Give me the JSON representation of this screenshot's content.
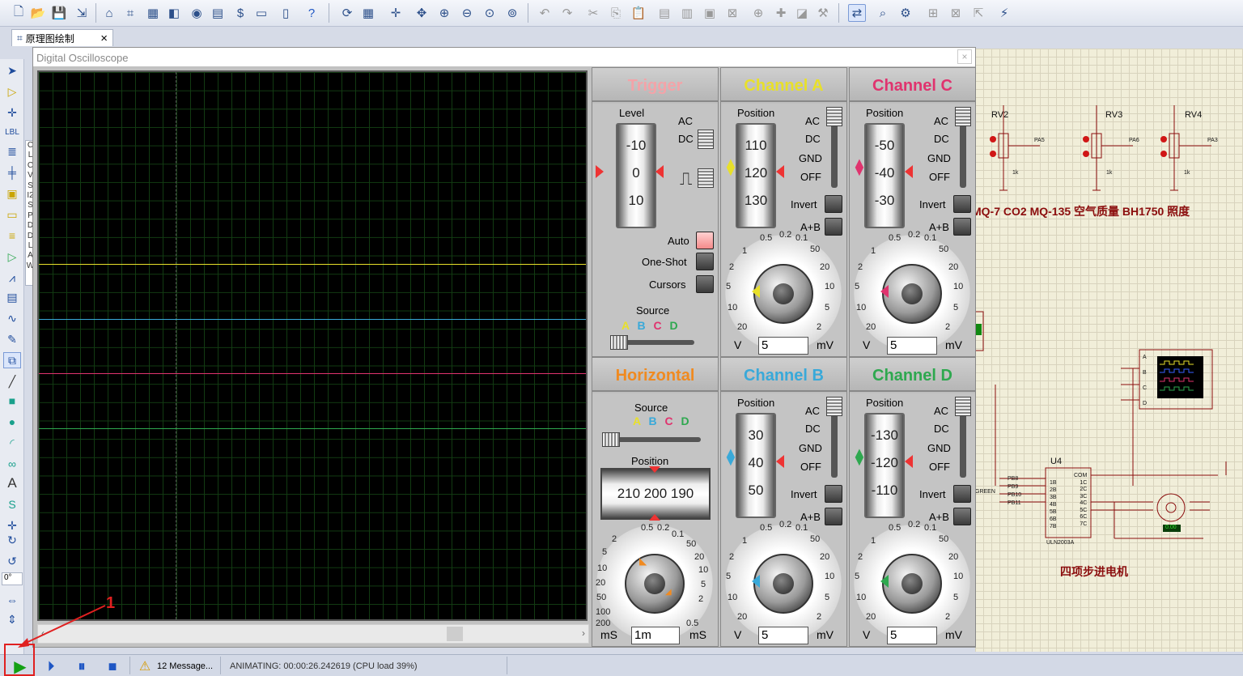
{
  "tab": {
    "label": "原理图绘制",
    "close": "×"
  },
  "device_strip": [
    "C",
    "L",
    "C",
    "V",
    "S",
    "I2",
    "S",
    "P",
    "D",
    "D",
    "L",
    "A",
    "W"
  ],
  "palette": {
    "angle_label": "0°"
  },
  "oscilloscope": {
    "title": "Digital Oscilloscope",
    "close": "×",
    "trigger": {
      "header": "Trigger",
      "level_label": "Level",
      "level_ticks": [
        "-10",
        "0",
        "10"
      ],
      "ac": "AC",
      "dc": "DC",
      "auto": "Auto",
      "one_shot": "One-Shot",
      "cursors": "Cursors",
      "source_label": "Source",
      "sources": [
        "A",
        "B",
        "C",
        "D"
      ]
    },
    "horizontal": {
      "header": "Horizontal",
      "source_label": "Source",
      "sources": [
        "A",
        "B",
        "C",
        "D"
      ],
      "position_label": "Position",
      "position_ticks": "210 200 190",
      "dial_labels": [
        "0.5",
        "0.2",
        "0.1",
        "50",
        "20",
        "10",
        "5",
        "2",
        "0.5",
        "200",
        "100",
        "50",
        "20",
        "10",
        "5",
        "2"
      ],
      "unit_left": "mS",
      "unit_right": "mS",
      "value": "1m"
    },
    "channel_a": {
      "header": "Channel A",
      "position_label": "Position",
      "ticks": [
        "110",
        "120",
        "130"
      ],
      "ac": "AC",
      "dc": "DC",
      "gnd": "GND",
      "off": "OFF",
      "invert": "Invert",
      "apb": "A+B",
      "unit_left": "V",
      "unit_right": "mV",
      "value": "5",
      "dial_labels": [
        "0.5",
        "0.2",
        "0.1",
        "50",
        "20",
        "10",
        "5",
        "2",
        "20",
        "10",
        "5",
        "2",
        "1"
      ]
    },
    "channel_b": {
      "header": "Channel B",
      "position_label": "Position",
      "ticks": [
        "30",
        "40",
        "50"
      ],
      "ac": "AC",
      "dc": "DC",
      "gnd": "GND",
      "off": "OFF",
      "invert": "Invert",
      "apb": "A+B",
      "unit_left": "V",
      "unit_right": "mV",
      "value": "5",
      "dial_labels": [
        "0.5",
        "0.2",
        "0.1",
        "50",
        "20",
        "10",
        "5",
        "2",
        "20",
        "10",
        "5",
        "2",
        "1"
      ]
    },
    "channel_c": {
      "header": "Channel C",
      "position_label": "Position",
      "ticks": [
        "-50",
        "-40",
        "-30"
      ],
      "ac": "AC",
      "dc": "DC",
      "gnd": "GND",
      "off": "OFF",
      "invert": "Invert",
      "apb": "A+B",
      "unit_left": "V",
      "unit_right": "mV",
      "value": "5",
      "dial_labels": [
        "0.5",
        "0.2",
        "0.1",
        "50",
        "20",
        "10",
        "5",
        "2",
        "20",
        "10",
        "5",
        "2",
        "1"
      ]
    },
    "channel_d": {
      "header": "Channel D",
      "position_label": "Position",
      "ticks": [
        "-130",
        "-120",
        "-110"
      ],
      "ac": "AC",
      "dc": "DC",
      "gnd": "GND",
      "off": "OFF",
      "invert": "Invert",
      "apb": "A+B",
      "unit_left": "V",
      "unit_right": "mV",
      "value": "5",
      "dial_labels": [
        "0.5",
        "0.2",
        "0.1",
        "50",
        "20",
        "10",
        "5",
        "2",
        "20",
        "10",
        "5",
        "2",
        "1"
      ]
    },
    "colors": {
      "a": "#e8e02a",
      "b": "#39a9d9",
      "c": "#e0336e",
      "d": "#2ea84f",
      "trigger": "#f4a3a8",
      "horizontal": "#f08a20"
    }
  },
  "schematic": {
    "labels": {
      "rv2": "RV2",
      "rv3": "RV3",
      "rv4": "RV4",
      "pa5": "PA5",
      "pa6": "PA6",
      "pa3": "PA3",
      "k1": "1k",
      "k2": "1k",
      "k3": "1k"
    },
    "sensor_labels": "MQ-7 CO2   MQ-135 空气质量  BH1750 照度",
    "u4": "U4",
    "chip": "ULN2003A",
    "stepper_label": "四项步进电机",
    "green_label": "GREEN",
    "scope_pins": [
      "A",
      "B",
      "C",
      "D"
    ],
    "motor_value": "0.00",
    "pins_left": [
      "PB8",
      "PB9",
      "PB10",
      "PB11"
    ],
    "chip_left_pins": [
      "1B",
      "2B",
      "3B",
      "4B",
      "5B",
      "6B",
      "7B"
    ],
    "chip_right_pins": [
      "COM",
      "1C",
      "2C",
      "3C",
      "4C",
      "5C",
      "6C",
      "7C"
    ]
  },
  "status": {
    "messages": "12 Message...",
    "animating": "ANIMATING: 00:00:26.242619 (CPU load 39%)",
    "annotation": "1"
  }
}
